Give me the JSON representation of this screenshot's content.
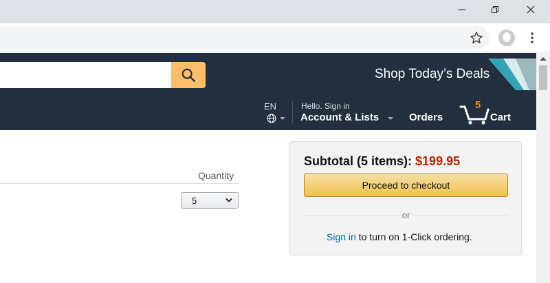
{
  "browser": {
    "window_controls": [
      "minimize-icon",
      "restore-icon",
      "close-icon"
    ],
    "toolbar_icons": [
      "bookmark-star-icon",
      "profile-avatar-icon",
      "menu-kebab-icon"
    ]
  },
  "header": {
    "search_placeholder": "",
    "search_icon": "magnifier-icon",
    "deals_text": "Shop Today’s Deals",
    "language": "EN",
    "account_greeting": "Hello. Sign in",
    "account_label": "Account & Lists",
    "orders_label": "Orders",
    "cart_count": "5",
    "cart_label": "Cart",
    "colors": {
      "nav_bg": "#232f3e",
      "search_button": "#febd69",
      "cart_count": "#f08804"
    }
  },
  "cart": {
    "quantity_header": "Quantity",
    "quantity_value": "5"
  },
  "subtotal": {
    "label": "Subtotal (5 items):",
    "price": "$199.95",
    "checkout_label": "Proceed to checkout",
    "or_text": "or",
    "signin_link": "Sign in",
    "oneclick_text": " to turn on 1-Click ordering.",
    "colors": {
      "price": "#b12704",
      "link": "#0066c0",
      "button": "#f0c14b"
    }
  }
}
